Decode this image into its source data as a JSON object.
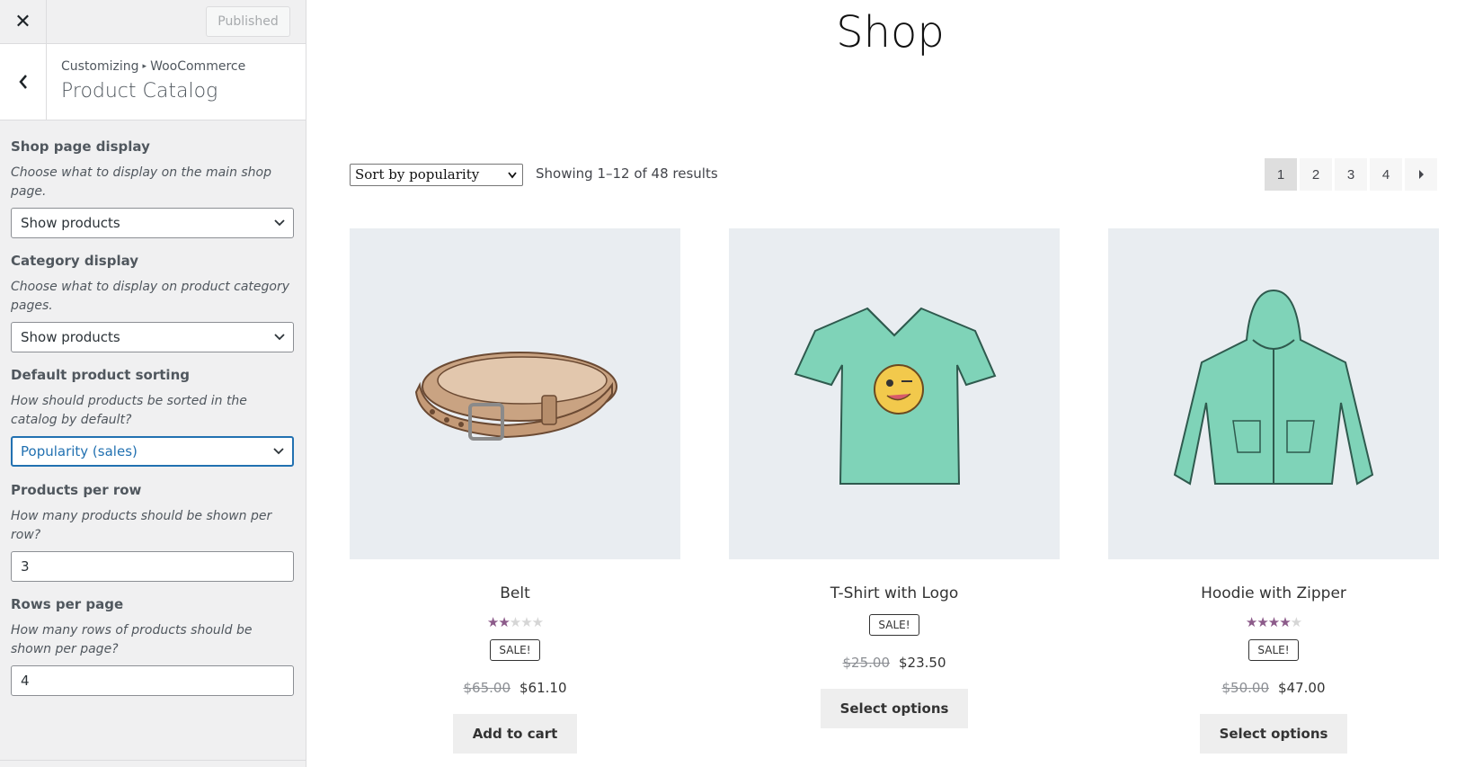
{
  "customizer": {
    "close_icon": "close-icon",
    "publish_label": "Published",
    "breadcrumb": {
      "parent": "Customizing",
      "separator": "▸",
      "child": "WooCommerce"
    },
    "section_title": "Product Catalog",
    "controls": {
      "shop_display": {
        "label": "Shop page display",
        "description": "Choose what to display on the main shop page.",
        "value": "Show products"
      },
      "category_display": {
        "label": "Category display",
        "description": "Choose what to display on product category pages.",
        "value": "Show products"
      },
      "default_sorting": {
        "label": "Default product sorting",
        "description": "How should products be sorted in the catalog by default?",
        "value": "Popularity (sales)"
      },
      "products_per_row": {
        "label": "Products per row",
        "description": "How many products should be shown per row?",
        "value": "3"
      },
      "rows_per_page": {
        "label": "Rows per page",
        "description": "How many rows of products should be shown per page?",
        "value": "4"
      }
    }
  },
  "shop": {
    "title": "Shop",
    "sort_value": "Sort by popularity",
    "result_count": "Showing 1–12 of 48 results",
    "pagination": {
      "pages": [
        "1",
        "2",
        "3",
        "4"
      ],
      "current": "1",
      "next_icon": "next-arrow-icon"
    },
    "products": [
      {
        "name": "Belt",
        "rating": 2,
        "rating_max": 5,
        "sale_label": "SALE!",
        "old_price": "$65.00",
        "price": "$61.10",
        "button": "Add to cart"
      },
      {
        "name": "T-Shirt with Logo",
        "sale_label": "SALE!",
        "old_price": "$25.00",
        "price": "$23.50",
        "button": "Select options"
      },
      {
        "name": "Hoodie with Zipper",
        "rating": 4,
        "rating_max": 5,
        "sale_label": "SALE!",
        "old_price": "$50.00",
        "price": "$47.00",
        "button": "Select options"
      }
    ]
  },
  "colors": {
    "accent": "#2271b1",
    "star": "#8c5b8a",
    "product_bg": "#e9edf1",
    "sidebar_bg": "#f0f0f1"
  }
}
